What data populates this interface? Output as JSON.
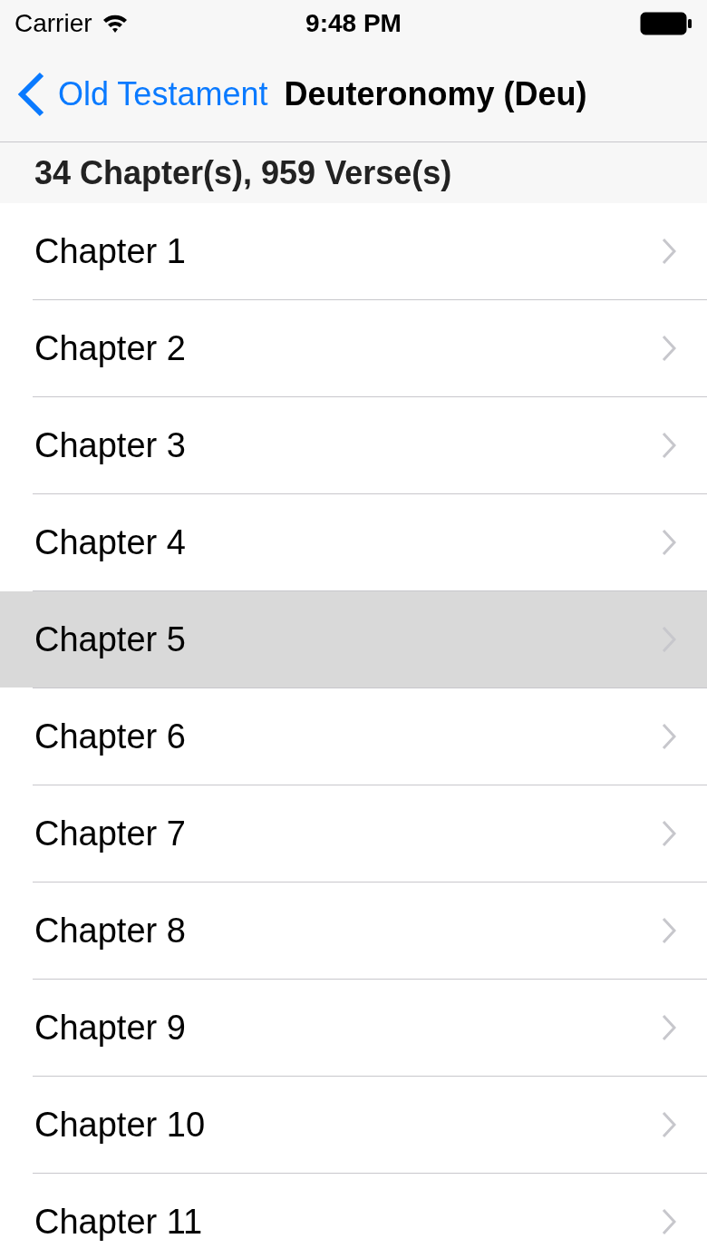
{
  "status_bar": {
    "carrier": "Carrier",
    "time": "9:48 PM"
  },
  "nav_bar": {
    "back_label": "Old Testament",
    "title": "Deuteronomy (Deu)"
  },
  "section_header": "34 Chapter(s), 959 Verse(s)",
  "chapters": [
    {
      "label": "Chapter 1",
      "selected": false
    },
    {
      "label": "Chapter 2",
      "selected": false
    },
    {
      "label": "Chapter 3",
      "selected": false
    },
    {
      "label": "Chapter 4",
      "selected": false
    },
    {
      "label": "Chapter 5",
      "selected": true
    },
    {
      "label": "Chapter 6",
      "selected": false
    },
    {
      "label": "Chapter 7",
      "selected": false
    },
    {
      "label": "Chapter 8",
      "selected": false
    },
    {
      "label": "Chapter 9",
      "selected": false
    },
    {
      "label": "Chapter 10",
      "selected": false
    },
    {
      "label": "Chapter 11",
      "selected": false
    }
  ]
}
